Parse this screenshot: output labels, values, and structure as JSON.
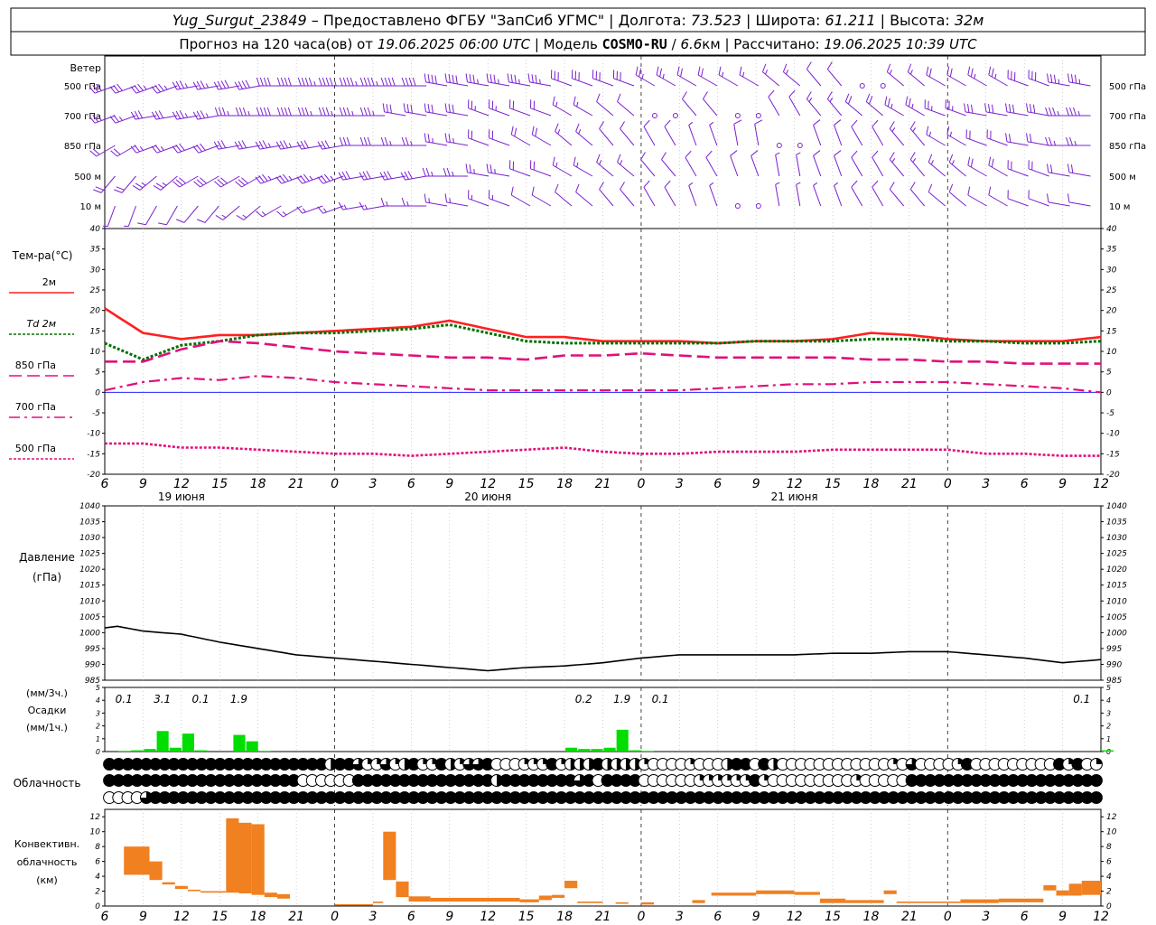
{
  "header": {
    "line1": [
      {
        "text": "Yug_Surgut_23849",
        "style": "italic"
      },
      {
        "text": " – Предоставлено ФГБУ \"ЗапСиб УГМС\" | Долгота: ",
        "style": "normal"
      },
      {
        "text": "73.523",
        "style": "italic"
      },
      {
        "text": " | Широта: ",
        "style": "normal"
      },
      {
        "text": "61.211",
        "style": "italic"
      },
      {
        "text": " | Высота: ",
        "style": "normal"
      },
      {
        "text": "32м",
        "style": "italic"
      }
    ],
    "line2": [
      {
        "text": "Прогноз на 120 часа(ов) от ",
        "style": "normal"
      },
      {
        "text": "19.06.2025 06:00 UTC",
        "style": "italic"
      },
      {
        "text": "  | Модель ",
        "style": "normal"
      },
      {
        "text": "COSMO-RU",
        "style": "bold"
      },
      {
        "text": " / ",
        "style": "normal"
      },
      {
        "text": "6.6",
        "style": "italic"
      },
      {
        "text": "км | Рассчитано: ",
        "style": "normal"
      },
      {
        "text": "19.06.2025 10:39 UTC",
        "style": "italic"
      }
    ]
  },
  "axis": {
    "hour_ticks": [
      "6",
      "9",
      "12",
      "15",
      "18",
      "21",
      "0",
      "3",
      "6",
      "9",
      "12",
      "15",
      "18",
      "21",
      "0",
      "3",
      "6",
      "9",
      "12",
      "15",
      "18",
      "21",
      "0",
      "3",
      "6",
      "9",
      "12"
    ],
    "day_labels": [
      "19 июня",
      "20 июня",
      "21 июня"
    ],
    "midnight_index": [
      6,
      14,
      22
    ]
  },
  "colors": {
    "t2m": "#ff2020",
    "td": "#007000",
    "t850": "#e0107a",
    "t700": "#e0107a",
    "t500": "#e0107a",
    "zero": "#0000ff",
    "wind": "#7a1fd0",
    "pressure": "#000000",
    "precip": "#00dd00",
    "conv": "#f08020",
    "grid": "#b0b0b0"
  },
  "panels": {
    "wind": {
      "title": "Ветер",
      "levels": [
        "500 гПа",
        "700 гПа",
        "850 гПа",
        "500 м",
        "10 м"
      ]
    },
    "temp": {
      "title": "Тем-ра(°С)",
      "legend": [
        {
          "label": "2м",
          "series": "t2m"
        },
        {
          "label": "Td  2м",
          "series": "td"
        },
        {
          "label": "850 гПа",
          "series": "t850"
        },
        {
          "label": "700 гПа",
          "series": "t700"
        },
        {
          "label": "500 гПа",
          "series": "t500"
        }
      ]
    },
    "pressure": {
      "title": "Давление",
      "unit": "(гПа)"
    },
    "precip": {
      "unit3h": "(мм/3ч.)",
      "title": "Осадки",
      "unit1h": "(мм/1ч.)"
    },
    "cloud": {
      "title": "Облачность"
    },
    "conv": {
      "title_lines": [
        "Конвективн.",
        "облачность",
        "(км)"
      ]
    }
  },
  "chart_data": [
    {
      "type": "line",
      "id": "temperature",
      "title": "Тем-ра(°С)",
      "ylim": [
        -20,
        40
      ],
      "yticks": [
        -20,
        -15,
        -10,
        -5,
        0,
        5,
        10,
        15,
        20,
        25,
        30,
        35,
        40
      ],
      "x_hours": [
        0,
        3,
        6,
        9,
        12,
        15,
        18,
        21,
        24,
        27,
        30,
        33,
        36,
        39,
        42,
        45,
        48,
        51,
        54,
        57,
        60,
        63,
        66,
        69,
        72,
        75,
        78
      ],
      "series": [
        {
          "name": "2м",
          "key": "t2m",
          "values": [
            20.5,
            14.5,
            13,
            14,
            14,
            14.5,
            15,
            15.5,
            16,
            17.5,
            15.5,
            13.5,
            13.5,
            12.5,
            12.5,
            12.5,
            12,
            12.5,
            12.5,
            13,
            14.5,
            14,
            13,
            12.5,
            12.5,
            12.5,
            13.5
          ]
        },
        {
          "name": "Td 2м",
          "key": "td",
          "values": [
            12,
            8,
            11.5,
            12.5,
            14,
            14.5,
            14.5,
            15,
            15.5,
            16.5,
            14.5,
            12.5,
            12,
            12,
            12,
            12,
            12,
            12.5,
            12.5,
            12.5,
            13,
            13,
            12.5,
            12.5,
            12,
            12,
            12.5
          ]
        },
        {
          "name": "850 гПа",
          "key": "t850",
          "values": [
            7.5,
            7.5,
            10.5,
            12.5,
            12,
            11,
            10,
            9.5,
            9,
            8.5,
            8.5,
            8,
            9,
            9,
            9.5,
            9,
            8.5,
            8.5,
            8.5,
            8.5,
            8,
            8,
            7.5,
            7.5,
            7,
            7,
            7
          ]
        },
        {
          "name": "700 гПа",
          "key": "t700",
          "values": [
            0.5,
            2.5,
            3.5,
            3,
            4,
            3.5,
            2.5,
            2,
            1.5,
            1,
            0.5,
            0.5,
            0.5,
            0.5,
            0.5,
            0.5,
            1,
            1.5,
            2,
            2,
            2.5,
            2.5,
            2.5,
            2,
            1.5,
            1,
            0
          ]
        },
        {
          "name": "500 гПа",
          "key": "t500",
          "values": [
            -12.5,
            -12.5,
            -13.5,
            -13.5,
            -14,
            -14.5,
            -15,
            -15,
            -15.5,
            -15,
            -14.5,
            -14,
            -13.5,
            -14.5,
            -15,
            -15,
            -14.5,
            -14.5,
            -14.5,
            -14,
            -14,
            -14,
            -14,
            -15,
            -15,
            -15.5,
            -15.5
          ]
        }
      ]
    },
    {
      "type": "line",
      "id": "pressure",
      "title": "Давление",
      "ylim": [
        985,
        1040
      ],
      "yticks": [
        985,
        990,
        995,
        1000,
        1005,
        1010,
        1015,
        1020,
        1025,
        1030,
        1035,
        1040
      ],
      "x_hours": [
        0,
        1,
        3,
        6,
        9,
        12,
        15,
        18,
        21,
        24,
        27,
        30,
        33,
        36,
        39,
        42,
        45,
        48,
        51,
        54,
        57,
        60,
        63,
        66,
        69,
        72,
        75,
        78
      ],
      "series": [
        {
          "name": "pressure",
          "values": [
            1001.5,
            1002,
            1000.5,
            999.5,
            997,
            995,
            993,
            992,
            991,
            990,
            989,
            988,
            989,
            989.5,
            990.5,
            992,
            993,
            993,
            993,
            993,
            993.5,
            993.5,
            994,
            994,
            993,
            992,
            990.5,
            991.5
          ]
        }
      ]
    },
    {
      "type": "bar",
      "id": "precipitation",
      "title": "Осадки",
      "ylim": [
        0,
        5
      ],
      "yticks": [
        0,
        1,
        2,
        3,
        4,
        5
      ],
      "x_hours": [
        0,
        1,
        2,
        3,
        4,
        5,
        6,
        7,
        8,
        9,
        10,
        11,
        12,
        13,
        14,
        15,
        36,
        37,
        38,
        39,
        40,
        41,
        42,
        43,
        44,
        45,
        78
      ],
      "values": [
        0,
        0.05,
        0.1,
        0.2,
        1.6,
        0.3,
        1.4,
        0.1,
        0,
        0,
        1.3,
        0.8,
        0.05,
        0,
        0,
        0,
        0.3,
        0.2,
        0.2,
        0.3,
        1.7,
        0.1,
        0.05,
        0,
        0,
        0,
        0.1
      ],
      "totals_3h": [
        {
          "hour": 1.5,
          "value": "0.1"
        },
        {
          "hour": 4.5,
          "value": "3.1"
        },
        {
          "hour": 7.5,
          "value": "0.1"
        },
        {
          "hour": 10.5,
          "value": "1.9"
        },
        {
          "hour": 37.5,
          "value": "0.2"
        },
        {
          "hour": 40.5,
          "value": "1.9"
        },
        {
          "hour": 43.5,
          "value": "0.1"
        },
        {
          "hour": 76.5,
          "value": "0.1"
        }
      ]
    },
    {
      "type": "bar",
      "id": "convective",
      "title": "Конвективн. облачность",
      "ylim": [
        0,
        13
      ],
      "yticks": [
        0,
        2,
        4,
        6,
        8,
        10,
        12
      ],
      "bars": [
        {
          "x0": 1.5,
          "x1": 3.5,
          "base": 4.2,
          "top": 8
        },
        {
          "x0": 3.5,
          "x1": 4.5,
          "base": 3.5,
          "top": 6
        },
        {
          "x0": 4.5,
          "x1": 5.5,
          "base": 2.9,
          "top": 3.2
        },
        {
          "x0": 5.5,
          "x1": 6.5,
          "base": 2.3,
          "top": 2.7
        },
        {
          "x0": 6.5,
          "x1": 7.5,
          "base": 2.0,
          "top": 2.2
        },
        {
          "x0": 7.5,
          "x1": 9.5,
          "base": 1.8,
          "top": 2.0
        },
        {
          "x0": 9.5,
          "x1": 10.5,
          "base": 1.8,
          "top": 11.8
        },
        {
          "x0": 10.5,
          "x1": 11.5,
          "base": 1.7,
          "top": 11.2
        },
        {
          "x0": 11.5,
          "x1": 12.5,
          "base": 1.5,
          "top": 11
        },
        {
          "x0": 12.5,
          "x1": 13.5,
          "base": 1.2,
          "top": 1.8
        },
        {
          "x0": 13.5,
          "x1": 14.5,
          "base": 1.0,
          "top": 1.6
        },
        {
          "x0": 18,
          "x1": 21,
          "base": 0.15,
          "top": 0.25
        },
        {
          "x0": 21,
          "x1": 21.8,
          "base": 0.4,
          "top": 0.6
        },
        {
          "x0": 21.8,
          "x1": 22.8,
          "base": 3.5,
          "top": 10
        },
        {
          "x0": 22.8,
          "x1": 23.8,
          "base": 1.2,
          "top": 3.3
        },
        {
          "x0": 23.8,
          "x1": 25.5,
          "base": 0.6,
          "top": 1.3
        },
        {
          "x0": 25.5,
          "x1": 32.5,
          "base": 0.6,
          "top": 1.1
        },
        {
          "x0": 32.5,
          "x1": 34,
          "base": 0.5,
          "top": 0.9
        },
        {
          "x0": 34,
          "x1": 35,
          "base": 0.8,
          "top": 1.4
        },
        {
          "x0": 35,
          "x1": 36,
          "base": 1.1,
          "top": 1.5
        },
        {
          "x0": 36,
          "x1": 37,
          "base": 2.4,
          "top": 3.4
        },
        {
          "x0": 37,
          "x1": 39,
          "base": 0.4,
          "top": 0.6
        },
        {
          "x0": 40,
          "x1": 41,
          "base": 0.3,
          "top": 0.5
        },
        {
          "x0": 42,
          "x1": 43,
          "base": 0.2,
          "top": 0.5
        },
        {
          "x0": 46,
          "x1": 47,
          "base": 0.4,
          "top": 0.8
        },
        {
          "x0": 47.5,
          "x1": 51,
          "base": 1.4,
          "top": 1.8
        },
        {
          "x0": 51,
          "x1": 54,
          "base": 1.6,
          "top": 2.1
        },
        {
          "x0": 54,
          "x1": 56,
          "base": 1.5,
          "top": 1.9
        },
        {
          "x0": 56,
          "x1": 58,
          "base": 0.4,
          "top": 1.0
        },
        {
          "x0": 58,
          "x1": 61,
          "base": 0.4,
          "top": 0.8
        },
        {
          "x0": 61,
          "x1": 62,
          "base": 1.6,
          "top": 2.1
        },
        {
          "x0": 62,
          "x1": 67,
          "base": 0.4,
          "top": 0.6
        },
        {
          "x0": 67,
          "x1": 70,
          "base": 0.4,
          "top": 0.9
        },
        {
          "x0": 70,
          "x1": 73.5,
          "base": 0.5,
          "top": 1.0
        },
        {
          "x0": 73.5,
          "x1": 74.5,
          "base": 2.1,
          "top": 2.8
        },
        {
          "x0": 74.5,
          "x1": 75.5,
          "base": 1.4,
          "top": 2.1
        },
        {
          "x0": 75.5,
          "x1": 76.5,
          "base": 1.4,
          "top": 3.0
        },
        {
          "x0": 76.5,
          "x1": 78,
          "base": 1.5,
          "top": 3.4
        }
      ]
    }
  ],
  "cloud_rows": {
    "legend": "0=ясно, 1=1/4, 2=1/2, 3=3/4, 4=сплошная",
    "upper": "444444444444444444444444244311312411421334000111412224222210000100024404200000000000010300001400000000041401",
    "middle": "444444444444444444444000000444444444444444244444444340444400000011111141000000000100000444444444444444444444",
    "lower": "000034444444444444444444444444444444444444444444444444444444444444444444444444444444444444444444444444444444"
  },
  "wind_rows": {
    "note": "direction deg (from), speed m/s; one record per level per barb column",
    "500 гПа": [
      [
        250,
        12
      ],
      [
        250,
        14
      ],
      [
        260,
        15
      ],
      [
        260,
        16
      ],
      [
        270,
        16
      ],
      [
        270,
        18
      ],
      [
        270,
        18
      ],
      [
        270,
        17
      ],
      [
        280,
        16
      ],
      [
        280,
        15
      ],
      [
        280,
        14
      ],
      [
        290,
        13
      ],
      [
        290,
        12
      ],
      [
        300,
        10
      ],
      [
        300,
        8
      ],
      [
        300,
        7
      ],
      [
        310,
        6
      ],
      [
        320,
        5
      ],
      [
        0,
        0
      ],
      [
        310,
        6
      ],
      [
        300,
        8
      ],
      [
        300,
        10
      ],
      [
        290,
        12
      ],
      [
        280,
        15
      ]
    ],
    "700 гПа": [
      [
        250,
        10
      ],
      [
        260,
        12
      ],
      [
        260,
        14
      ],
      [
        270,
        15
      ],
      [
        270,
        16
      ],
      [
        270,
        15
      ],
      [
        270,
        14
      ],
      [
        280,
        13
      ],
      [
        280,
        12
      ],
      [
        290,
        11
      ],
      [
        290,
        9
      ],
      [
        300,
        7
      ],
      [
        310,
        5
      ],
      [
        0,
        0
      ],
      [
        320,
        4
      ],
      [
        0,
        0
      ],
      [
        330,
        5
      ],
      [
        320,
        6
      ],
      [
        310,
        8
      ],
      [
        300,
        10
      ],
      [
        290,
        11
      ],
      [
        280,
        12
      ],
      [
        280,
        13
      ],
      [
        270,
        14
      ]
    ],
    "850 гПа": [
      [
        240,
        8
      ],
      [
        250,
        10
      ],
      [
        250,
        12
      ],
      [
        260,
        13
      ],
      [
        260,
        14
      ],
      [
        260,
        13
      ],
      [
        270,
        12
      ],
      [
        270,
        11
      ],
      [
        280,
        10
      ],
      [
        290,
        9
      ],
      [
        300,
        8
      ],
      [
        310,
        6
      ],
      [
        320,
        5
      ],
      [
        330,
        4
      ],
      [
        340,
        3
      ],
      [
        350,
        4
      ],
      [
        0,
        0
      ],
      [
        340,
        4
      ],
      [
        330,
        5
      ],
      [
        320,
        6
      ],
      [
        300,
        7
      ],
      [
        290,
        8
      ],
      [
        280,
        9
      ],
      [
        270,
        10
      ]
    ],
    "500 м": [
      [
        220,
        8
      ],
      [
        230,
        10
      ],
      [
        240,
        12
      ],
      [
        240,
        13
      ],
      [
        250,
        14
      ],
      [
        250,
        14
      ],
      [
        260,
        13
      ],
      [
        260,
        12
      ],
      [
        270,
        11
      ],
      [
        280,
        10
      ],
      [
        290,
        8
      ],
      [
        300,
        7
      ],
      [
        310,
        6
      ],
      [
        320,
        5
      ],
      [
        330,
        4
      ],
      [
        340,
        4
      ],
      [
        350,
        3
      ],
      [
        340,
        4
      ],
      [
        330,
        5
      ],
      [
        320,
        6
      ],
      [
        310,
        7
      ],
      [
        300,
        8
      ],
      [
        290,
        9
      ],
      [
        280,
        9
      ]
    ],
    "10 м": [
      [
        200,
        3
      ],
      [
        210,
        4
      ],
      [
        220,
        5
      ],
      [
        230,
        6
      ],
      [
        240,
        6
      ],
      [
        250,
        7
      ],
      [
        260,
        7
      ],
      [
        270,
        7
      ],
      [
        280,
        6
      ],
      [
        290,
        6
      ],
      [
        300,
        5
      ],
      [
        310,
        5
      ],
      [
        320,
        4
      ],
      [
        330,
        4
      ],
      [
        340,
        3
      ],
      [
        0,
        0
      ],
      [
        350,
        3
      ],
      [
        340,
        3
      ],
      [
        330,
        4
      ],
      [
        320,
        4
      ],
      [
        310,
        5
      ],
      [
        300,
        5
      ],
      [
        290,
        5
      ],
      [
        280,
        5
      ]
    ]
  }
}
